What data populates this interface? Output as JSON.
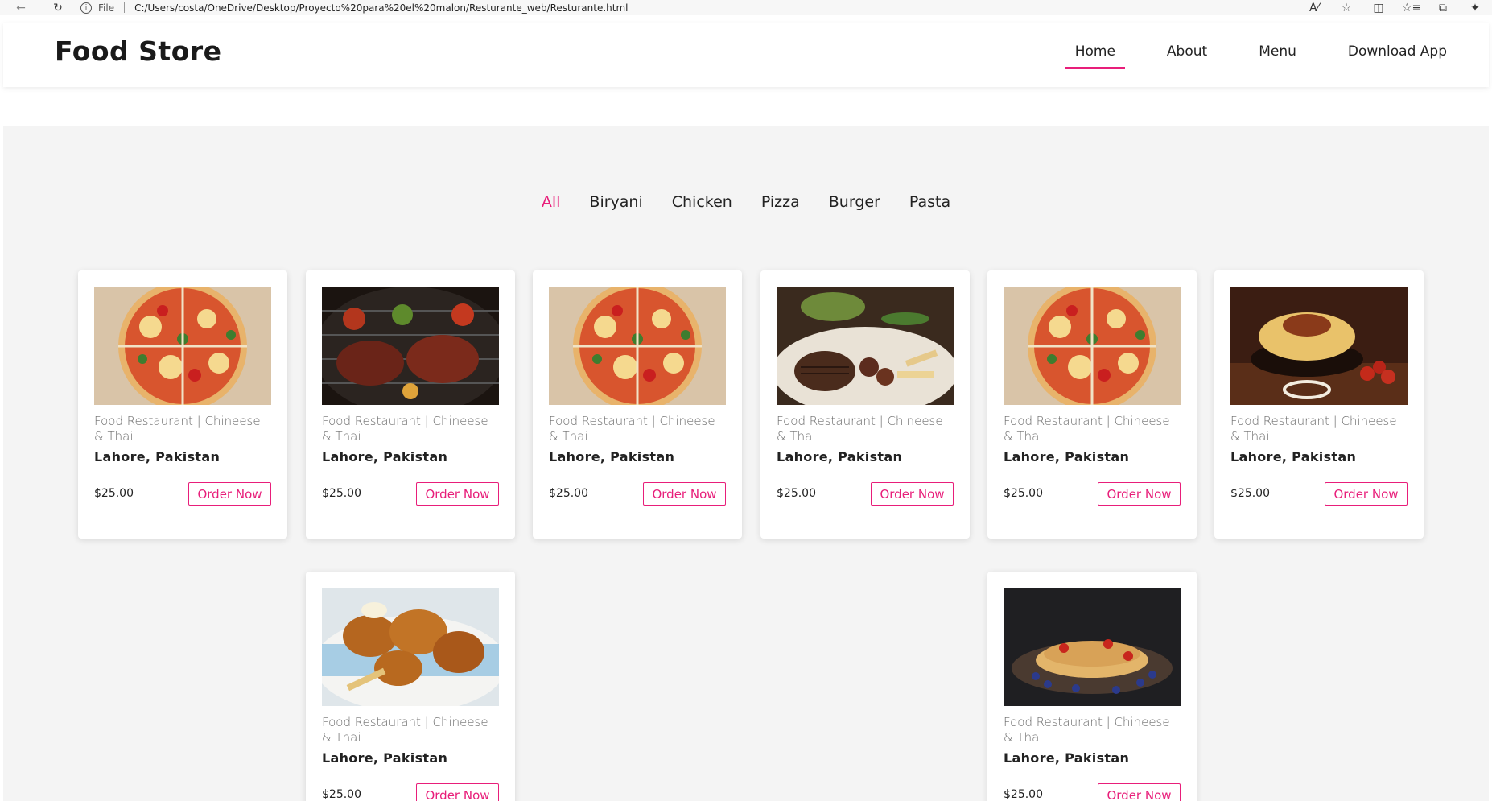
{
  "browser": {
    "file_label": "File",
    "url": "C:/Users/costa/OneDrive/Desktop/Proyecto%20para%20el%20malon/Resturante_web/Resturante.html"
  },
  "header": {
    "logo": "Food Store",
    "nav": [
      {
        "label": "Home",
        "active": true
      },
      {
        "label": "About",
        "active": false
      },
      {
        "label": "Menu",
        "active": false
      },
      {
        "label": "Download App",
        "active": false
      }
    ]
  },
  "filters": [
    {
      "label": "All",
      "active": true
    },
    {
      "label": "Biryani",
      "active": false
    },
    {
      "label": "Chicken",
      "active": false
    },
    {
      "label": "Pizza",
      "active": false
    },
    {
      "label": "Burger",
      "active": false
    },
    {
      "label": "Pasta",
      "active": false
    }
  ],
  "cards": [
    {
      "image": "pizza-photo",
      "description": "Food Restaurant | Chineese & Thai",
      "location": "Lahore, Pakistan",
      "price": "$25.00",
      "button": "Order Now"
    },
    {
      "image": "grilled-meat-photo",
      "description": "Food Restaurant | Chineese & Thai",
      "location": "Lahore, Pakistan",
      "price": "$25.00",
      "button": "Order Now"
    },
    {
      "image": "pizza-photo",
      "description": "Food Restaurant | Chineese & Thai",
      "location": "Lahore, Pakistan",
      "price": "$25.00",
      "button": "Order Now"
    },
    {
      "image": "steak-plate-photo",
      "description": "Food Restaurant | Chineese & Thai",
      "location": "Lahore, Pakistan",
      "price": "$25.00",
      "button": "Order Now"
    },
    {
      "image": "pizza-photo",
      "description": "Food Restaurant | Chineese & Thai",
      "location": "Lahore, Pakistan",
      "price": "$25.00",
      "button": "Order Now"
    },
    {
      "image": "pasta-bowl-photo",
      "description": "Food Restaurant | Chineese & Thai",
      "location": "Lahore, Pakistan",
      "price": "$25.00",
      "button": "Order Now"
    },
    {
      "image": "fried-chicken-photo",
      "description": "Food Restaurant | Chineese & Thai",
      "location": "Lahore, Pakistan",
      "price": "$25.00",
      "button": "Order Now"
    },
    {
      "image": "pancakes-berries-photo",
      "description": "Food Restaurant | Chineese & Thai",
      "location": "Lahore, Pakistan",
      "price": "$25.00",
      "button": "Order Now"
    }
  ],
  "colors": {
    "accent": "#e81e7a",
    "background": "#f4f4f4",
    "card": "#ffffff"
  }
}
